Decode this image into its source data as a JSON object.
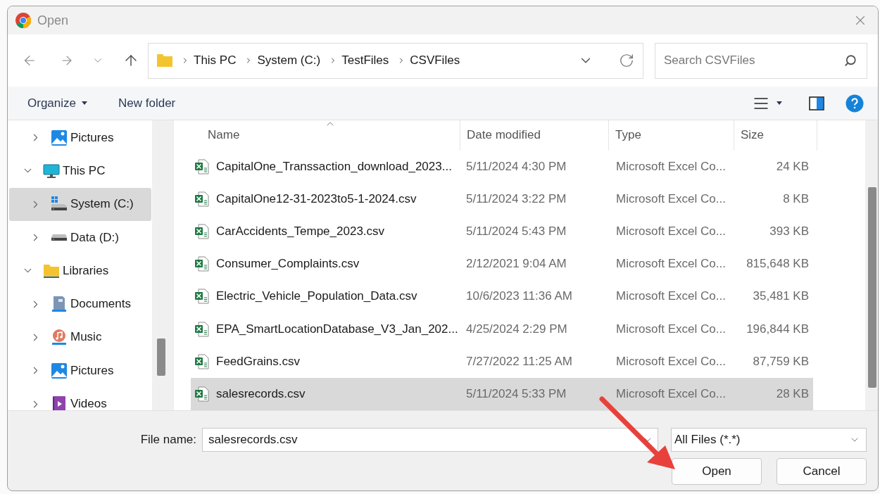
{
  "window": {
    "title": "Open"
  },
  "address": {
    "crumbs": [
      "This PC",
      "System (C:)",
      "TestFiles",
      "CSVFiles"
    ]
  },
  "search": {
    "placeholder": "Search CSVFiles"
  },
  "toolbar": {
    "organize": "Organize",
    "new_folder": "New folder"
  },
  "sidebar": {
    "items": [
      {
        "children": [
          {
            "label": "Pictures",
            "kind": "pictures",
            "expanded": false,
            "selected": false
          }
        ]
      },
      {
        "label": "This PC",
        "kind": "pc",
        "expanded": true,
        "selected": false,
        "children": [
          {
            "label": "System (C:)",
            "kind": "system_drive",
            "expanded": false,
            "selected": true
          },
          {
            "label": "Data (D:)",
            "kind": "drive",
            "expanded": false,
            "selected": false
          }
        ]
      },
      {
        "label": "Libraries",
        "kind": "library",
        "expanded": true,
        "selected": false,
        "children": [
          {
            "label": "Documents",
            "kind": "documents",
            "expanded": false,
            "selected": false
          },
          {
            "label": "Music",
            "kind": "music",
            "expanded": false,
            "selected": false
          },
          {
            "label": "Pictures",
            "kind": "pictures",
            "expanded": false,
            "selected": false
          },
          {
            "label": "Videos",
            "kind": "videos",
            "expanded": false,
            "selected": false
          }
        ]
      }
    ]
  },
  "file_list": {
    "columns": [
      {
        "label": "Name",
        "sorted": true
      },
      {
        "label": "Date modified",
        "sorted": false
      },
      {
        "label": "Type",
        "sorted": false
      },
      {
        "label": "Size",
        "sorted": false
      }
    ],
    "rows": [
      {
        "name": "CapitalOne_Transsaction_download_2023...",
        "date": "5/11/2024 4:30 PM",
        "type": "Microsoft Excel Co...",
        "size": "24 KB",
        "selected": false
      },
      {
        "name": "CapitalOne12-31-2023to5-1-2024.csv",
        "date": "5/11/2024 3:22 PM",
        "type": "Microsoft Excel Co...",
        "size": "8 KB",
        "selected": false
      },
      {
        "name": "CarAccidents_Tempe_2023.csv",
        "date": "5/11/2024 5:43 PM",
        "type": "Microsoft Excel Co...",
        "size": "393 KB",
        "selected": false
      },
      {
        "name": "Consumer_Complaints.csv",
        "date": "2/12/2021 9:04 AM",
        "type": "Microsoft Excel Co...",
        "size": "815,648 KB",
        "selected": false
      },
      {
        "name": "Electric_Vehicle_Population_Data.csv",
        "date": "10/6/2023 11:36 AM",
        "type": "Microsoft Excel Co...",
        "size": "35,481 KB",
        "selected": false
      },
      {
        "name": "EPA_SmartLocationDatabase_V3_Jan_202...",
        "date": "4/25/2024 2:29 PM",
        "type": "Microsoft Excel Co...",
        "size": "196,844 KB",
        "selected": false
      },
      {
        "name": "FeedGrains.csv",
        "date": "7/27/2022 11:25 AM",
        "type": "Microsoft Excel Co...",
        "size": "87,759 KB",
        "selected": false
      },
      {
        "name": "salesrecords.csv",
        "date": "5/11/2024 5:33 PM",
        "type": "Microsoft Excel Co...",
        "size": "28 KB",
        "selected": true
      }
    ]
  },
  "footer": {
    "file_name_label": "File name:",
    "file_name": "salesrecords.csv",
    "file_type": "All Files (*.*)",
    "buttons": [
      "Open",
      "Cancel"
    ]
  }
}
